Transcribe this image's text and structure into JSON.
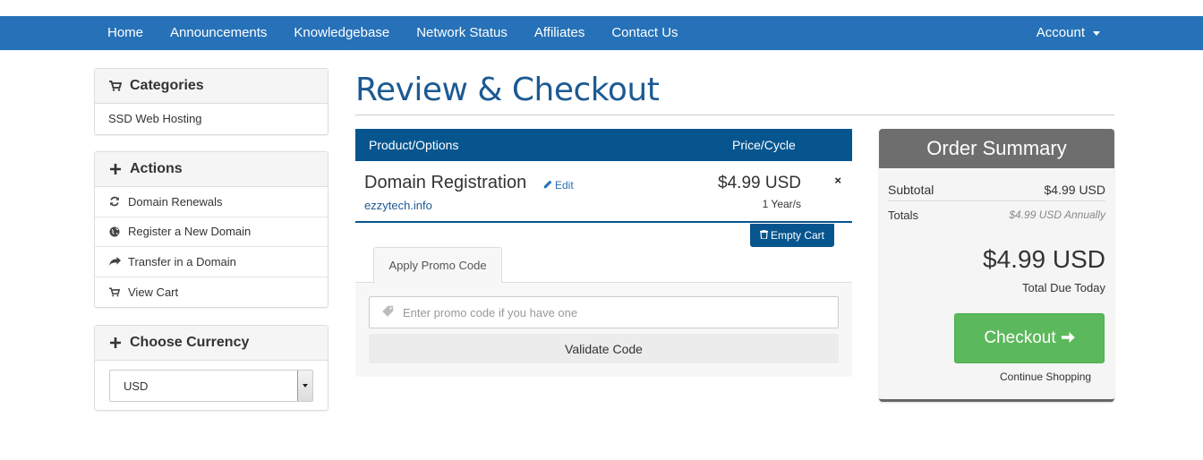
{
  "nav": {
    "items": [
      "Home",
      "Announcements",
      "Knowledgebase",
      "Network Status",
      "Affiliates",
      "Contact Us"
    ],
    "account_label": "Account"
  },
  "sidebar": {
    "categories": {
      "title": "Categories",
      "icon": "cart-icon",
      "items": [
        "SSD Web Hosting"
      ]
    },
    "actions": {
      "title": "Actions",
      "icon": "plus-icon",
      "items": [
        {
          "label": "Domain Renewals",
          "icon": "refresh-icon"
        },
        {
          "label": "Register a New Domain",
          "icon": "globe-icon"
        },
        {
          "label": "Transfer in a Domain",
          "icon": "share-icon"
        },
        {
          "label": "View Cart",
          "icon": "cart-icon"
        }
      ]
    },
    "currency": {
      "title": "Choose Currency",
      "icon": "plus-icon",
      "selected": "USD"
    }
  },
  "main": {
    "title": "Review & Checkout",
    "cart": {
      "col_product": "Product/Options",
      "col_price": "Price/Cycle",
      "item": {
        "name": "Domain Registration",
        "edit_label": "Edit",
        "domain": "ezzytech.info",
        "price": "$4.99 USD",
        "cycle": "1 Year/s",
        "remove_icon": "×"
      },
      "empty_cart_label": "Empty Cart"
    },
    "promo": {
      "tab_label": "Apply Promo Code",
      "input_placeholder": "Enter promo code if you have one",
      "validate_label": "Validate Code"
    }
  },
  "summary": {
    "title": "Order Summary",
    "subtotal_label": "Subtotal",
    "subtotal_value": "$4.99 USD",
    "totals_label": "Totals",
    "totals_value": "$4.99 USD Annually",
    "total_due": "$4.99 USD",
    "total_due_label": "Total Due Today",
    "checkout_label": "Checkout",
    "continue_label": "Continue Shopping"
  },
  "colors": {
    "nav_bg": "#2671b7",
    "table_head": "#07558f",
    "title": "#1c5a93",
    "checkout_green": "#5cb85c",
    "summary_head": "#6e6e6e"
  }
}
